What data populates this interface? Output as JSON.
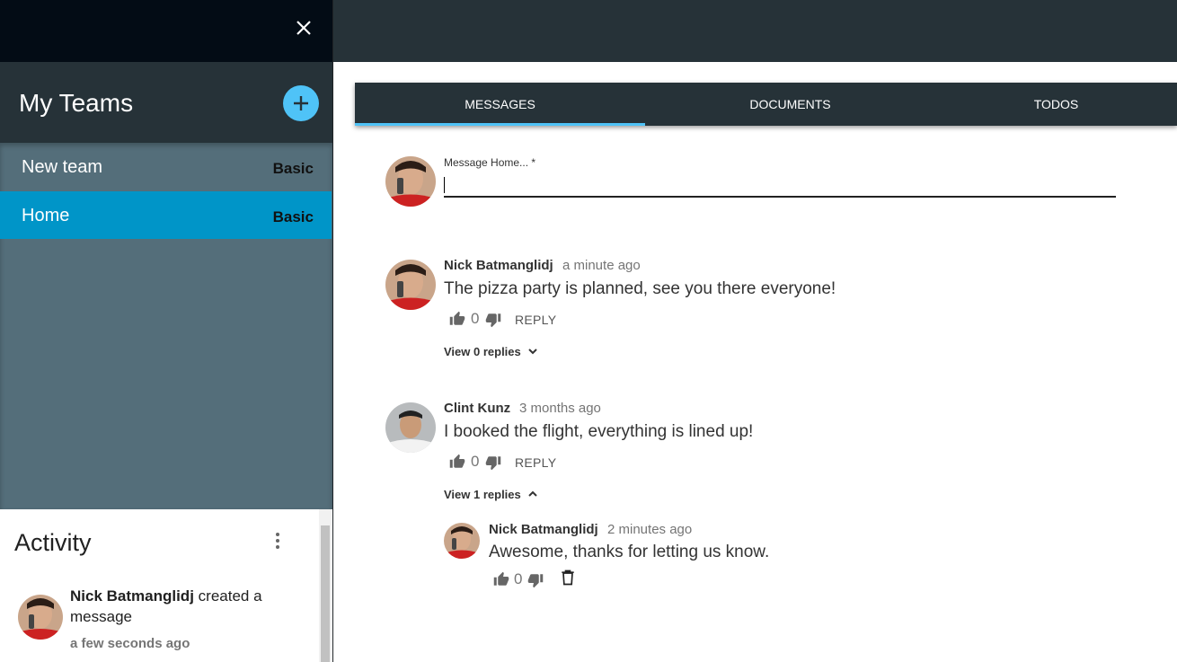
{
  "sidebar": {
    "teams_title": "My Teams",
    "teams": [
      {
        "name": "New team",
        "plan": "Basic",
        "selected": false
      },
      {
        "name": "Home",
        "plan": "Basic",
        "selected": true
      }
    ],
    "activity": {
      "title": "Activity",
      "items": [
        {
          "actor": "Nick Batmanglidj",
          "action": "created a message",
          "time": "a few seconds ago"
        }
      ]
    }
  },
  "tabs": [
    {
      "label": "MESSAGES",
      "active": true
    },
    {
      "label": "DOCUMENTS",
      "active": false
    },
    {
      "label": "TODOS",
      "active": false
    }
  ],
  "composer": {
    "label": "Message Home... *",
    "value": ""
  },
  "messages": [
    {
      "author": "Nick Batmanglidj",
      "time": "a minute ago",
      "text": "The pizza party is planned, see you there everyone!",
      "likes": "0",
      "reply_label": "REPLY",
      "view_replies": "View 0 replies"
    },
    {
      "author": "Clint Kunz",
      "time": "3 months ago",
      "text": "I booked the flight, everything is lined up!",
      "likes": "0",
      "reply_label": "REPLY",
      "view_replies": "View 1 replies",
      "replies": [
        {
          "author": "Nick Batmanglidj",
          "time": "2 minutes ago",
          "text": "Awesome, thanks for letting us know.",
          "likes": "0"
        }
      ]
    }
  ],
  "colors": {
    "dark": "#263238",
    "darker": "#030c15",
    "sidebar_list": "#546e7a",
    "selected": "#0095c8",
    "accent": "#4fc3f7"
  }
}
